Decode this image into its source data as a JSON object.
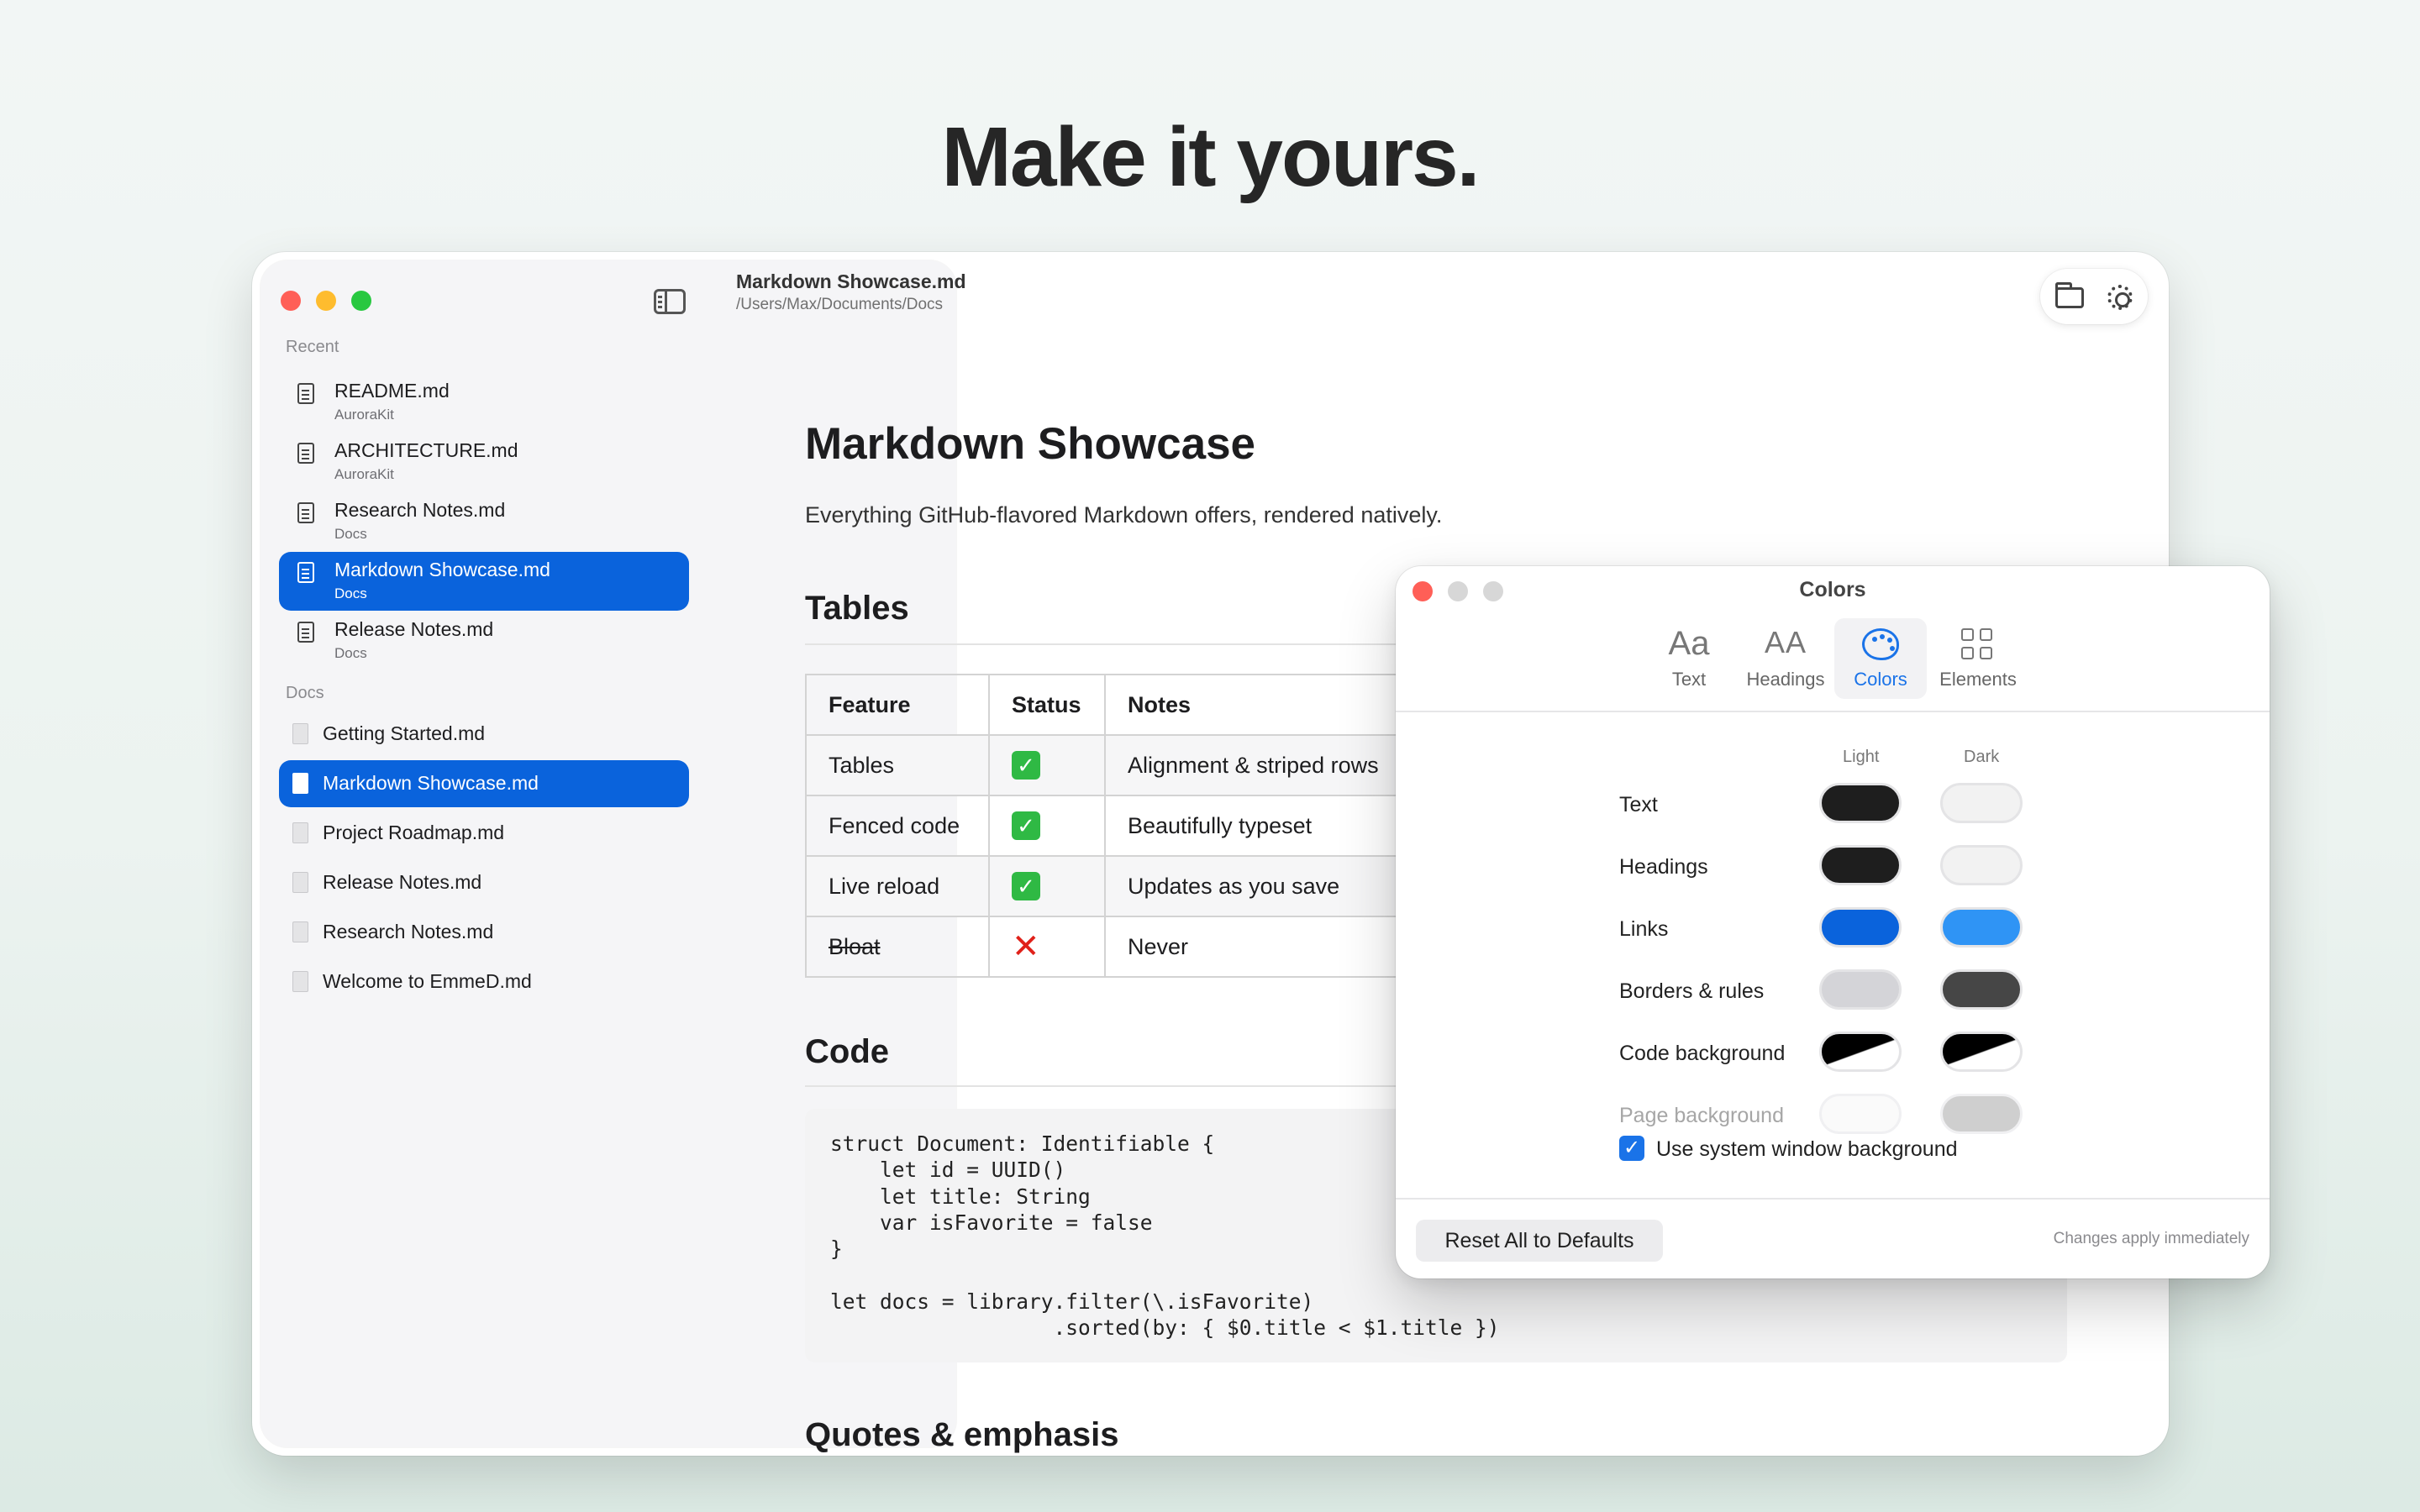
{
  "hero": {
    "title": "Make it yours."
  },
  "window": {
    "file_title": "Markdown Showcase.md",
    "file_path": "/Users/Max/Documents/Docs"
  },
  "sidebar": {
    "recent_label": "Recent",
    "recent": [
      {
        "name": "README.md",
        "folder": "AuroraKit",
        "selected": false
      },
      {
        "name": "ARCHITECTURE.md",
        "folder": "AuroraKit",
        "selected": false
      },
      {
        "name": "Research Notes.md",
        "folder": "Docs",
        "selected": false
      },
      {
        "name": "Markdown Showcase.md",
        "folder": "Docs",
        "selected": true
      },
      {
        "name": "Release Notes.md",
        "folder": "Docs",
        "selected": false
      }
    ],
    "docs_label": "Docs",
    "docs": [
      {
        "name": "Getting Started.md",
        "selected": false
      },
      {
        "name": "Markdown Showcase.md",
        "selected": true
      },
      {
        "name": "Project Roadmap.md",
        "selected": false
      },
      {
        "name": "Release Notes.md",
        "selected": false
      },
      {
        "name": "Research Notes.md",
        "selected": false
      },
      {
        "name": "Welcome to EmmeD.md",
        "selected": false
      }
    ]
  },
  "document": {
    "h1": "Markdown Showcase",
    "intro": "Everything GitHub-flavored Markdown offers, rendered natively.",
    "tables_heading": "Tables",
    "table": {
      "headers": [
        "Feature",
        "Status",
        "Notes"
      ],
      "rows": [
        {
          "feature": "Tables",
          "status": "check",
          "notes": "Alignment & striped rows"
        },
        {
          "feature": "Fenced code",
          "status": "check",
          "notes": "Beautifully typeset"
        },
        {
          "feature": "Live reload",
          "status": "check",
          "notes": "Updates as you save"
        },
        {
          "feature": "Bloat",
          "status": "cross",
          "notes": "Never"
        }
      ],
      "check_glyph": "✓",
      "cross_glyph": "✕"
    },
    "code_heading": "Code",
    "code": "struct Document: Identifiable {\n    let id = UUID()\n    let title: String\n    var isFavorite = false\n}\n\nlet docs = library.filter(\\.isFavorite)\n                  .sorted(by: { $0.title < $1.title })",
    "quotes_heading": "Quotes & emphasis"
  },
  "colors_panel": {
    "title": "Colors",
    "tabs": [
      {
        "label": "Text",
        "glyph": "Aa",
        "icon": "text-icon",
        "active": false
      },
      {
        "label": "Headings",
        "glyph": "AA",
        "icon": "headings-icon",
        "active": false
      },
      {
        "label": "Colors",
        "glyph": "",
        "icon": "palette-icon",
        "active": true
      },
      {
        "label": "Elements",
        "glyph": "",
        "icon": "grid-icon",
        "active": false
      }
    ],
    "light_label": "Light",
    "dark_label": "Dark",
    "rows": [
      {
        "label": "Text",
        "light": "#1e1e1e",
        "dark": "#f2f2f2",
        "disabled": false
      },
      {
        "label": "Headings",
        "light": "#1e1e1e",
        "dark": "#f2f2f2",
        "disabled": false
      },
      {
        "label": "Links",
        "light": "#0a63dc",
        "dark": "#2f94f5",
        "disabled": false
      },
      {
        "label": "Borders & rules",
        "light": "#d4d4d8",
        "dark": "#464646",
        "disabled": false
      },
      {
        "label": "Code background",
        "light": "split",
        "dark": "split",
        "disabled": false
      },
      {
        "label": "Page background",
        "light": "#fafafa",
        "dark": "#cfcfcf",
        "disabled": true
      }
    ],
    "system_bg_label": "Use system window background",
    "system_bg_checked": true,
    "checkmark": "✓",
    "reset_label": "Reset All to Defaults",
    "note": "Changes apply immediately"
  }
}
